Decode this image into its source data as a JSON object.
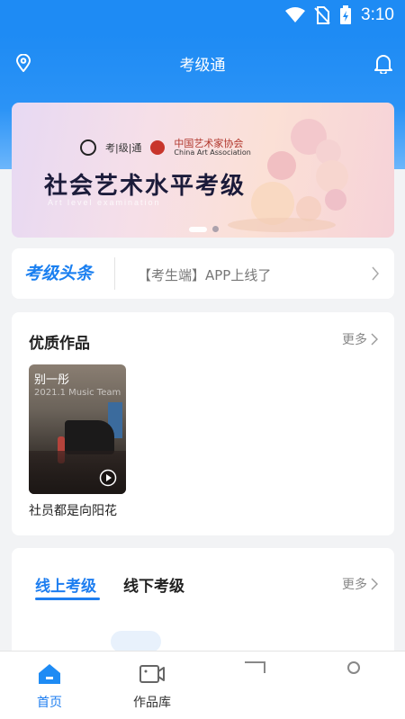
{
  "status_bar": {
    "time": "3:10"
  },
  "header": {
    "title": "考级通"
  },
  "banner": {
    "logo_left_text": "考|级|通",
    "logo_right_text": "中国艺术家协会",
    "logo_right_sub": "China Art Association",
    "title": "社会艺术水平考级",
    "subtitle": "Art level examination"
  },
  "news": {
    "brand": "考级头条",
    "headline": "【考生端】APP上线了"
  },
  "works": {
    "title": "优质作品",
    "more_label": "更多",
    "items": [
      {
        "overlay_title": "别一彤",
        "overlay_date": "2021.1 Music Team",
        "caption": "社员都是向阳花"
      }
    ]
  },
  "exams": {
    "tabs": [
      {
        "label": "线上考级",
        "active": true
      },
      {
        "label": "线下考级",
        "active": false
      }
    ],
    "more_label": "更多"
  },
  "tabbar": {
    "items": [
      {
        "label": "首页",
        "icon": "home-icon",
        "active": true
      },
      {
        "label": "作品库",
        "icon": "video-library-icon",
        "active": false
      }
    ]
  },
  "colors": {
    "primary": "#1e8bf4",
    "accent_text": "#1e7ef0"
  }
}
